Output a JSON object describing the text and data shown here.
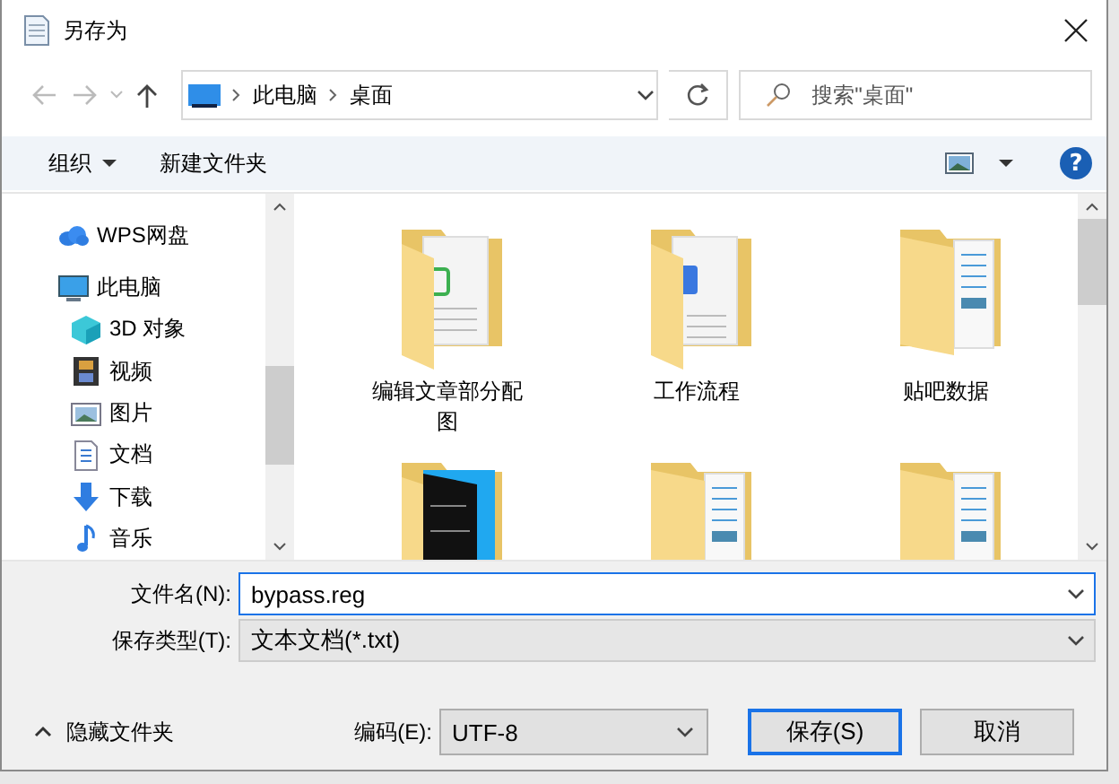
{
  "window": {
    "title": "另存为"
  },
  "nav": {
    "path": [
      "此电脑",
      "桌面"
    ],
    "search": {
      "placeholder": "搜索\"桌面\""
    }
  },
  "toolbar": {
    "organize": "组织",
    "new_folder": "新建文件夹",
    "help": "?"
  },
  "sidebar": {
    "items": [
      {
        "label": "WPS网盘",
        "kind": "cloud"
      },
      {
        "label": "此电脑",
        "kind": "pc",
        "children": [
          {
            "label": "3D 对象",
            "kind": "cube"
          },
          {
            "label": "视频",
            "kind": "film"
          },
          {
            "label": "图片",
            "kind": "image"
          },
          {
            "label": "文档",
            "kind": "doc"
          },
          {
            "label": "下载",
            "kind": "download"
          },
          {
            "label": "音乐",
            "kind": "music"
          }
        ]
      }
    ]
  },
  "files": [
    {
      "label": "编辑文章部分配图",
      "kind": "sheet"
    },
    {
      "label": "工作流程",
      "kind": "word"
    },
    {
      "label": "贴吧数据",
      "kind": "pages"
    },
    {
      "kind": "dark"
    },
    {
      "kind": "pages"
    },
    {
      "kind": "pages"
    }
  ],
  "form": {
    "filename_label": "文件名(N):",
    "filename": "bypass.reg",
    "type_label": "保存类型(T):",
    "type": "文本文档(*.txt)"
  },
  "footer": {
    "hide_folders": "隐藏文件夹",
    "encoding_label": "编码(E):",
    "encoding": "UTF-8",
    "save": "保存(S)",
    "cancel": "取消"
  }
}
